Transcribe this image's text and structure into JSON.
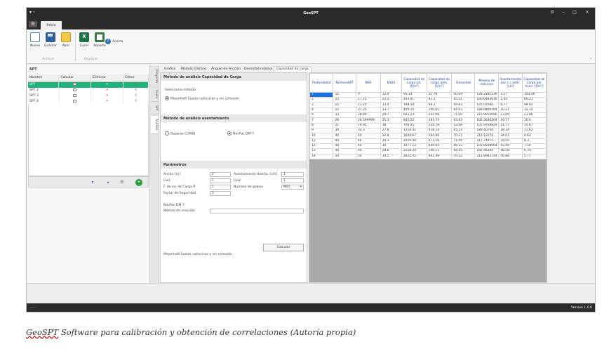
{
  "window": {
    "title": "GeoSPT",
    "controls": [
      "⊡",
      "–",
      "□",
      "×"
    ]
  },
  "menu": {
    "file_icon": "☰",
    "tab": "Inicio"
  },
  "ribbon": {
    "buttons": [
      {
        "label": "Nuevo",
        "icon": "new-file-icon"
      },
      {
        "label": "Guardar",
        "icon": "save-icon"
      },
      {
        "label": "Abrir",
        "icon": "open-folder-icon"
      },
      {
        "label": "Excel",
        "icon": "excel-icon"
      },
      {
        "label": "Reporte",
        "icon": "report-icon"
      }
    ],
    "about": "Acerca",
    "groups": [
      "Archivo",
      "Exportar"
    ]
  },
  "spt_panel": {
    "title": "SPT",
    "columns": [
      "Nombre",
      "Calcular",
      "Eliminar",
      "Editar"
    ],
    "rows": [
      {
        "name": "SPT",
        "selected": true
      },
      {
        "name": "SPT 2",
        "selected": false
      },
      {
        "name": "SPT 3",
        "selected": false
      },
      {
        "name": "SPT 4",
        "selected": false
      }
    ],
    "side_tabs": [
      "Proyecto",
      "Suelo",
      "SPT",
      "Análisis"
    ]
  },
  "subtabs": [
    "Grafico",
    "Módulo Elástico",
    "Ángulo de Fricción",
    "Densidad relativa",
    "Capacidad de carga"
  ],
  "capacity": {
    "section1_title": "Método de análisis Capacidad de Carga",
    "select_method": "Seleccione método",
    "method_option": "Meyerhoft Suelos cohesivos y sin cohesión",
    "section2_title": "Método de análisis asentamiento",
    "settlement_options": [
      "Bazaraa (1996)",
      "NavFac DM 7"
    ],
    "section3_title": "Parámetros",
    "params": {
      "ancho_label": "Ancho [m]",
      "ancho_value": "2",
      "asent_label": "Asentamiento diseño. [cm]",
      "asent_value": "1",
      "cw1_label": "Cw1",
      "cw1_value": "1",
      "cw2_label": "Cw2",
      "cw2_value": "1",
      "finc_label": "F. de inc de Carga R",
      "finc_value": "1",
      "golpes_label": "Numero de golpes",
      "golpes_value": "N60",
      "fs_label": "Factor de Seguridad",
      "fs_value": "3"
    },
    "navfac_title": "NavFac DM 7",
    "modulo_label": "Módulo de reacción",
    "calc_button": "Calcular",
    "footer_text": "Meyerhoft Suelos cohesivos y sin cohesión"
  },
  "grid": {
    "headers": [
      "Profundidad",
      "NumeroSPT",
      "N60",
      "N160",
      "Capacidad de carga ult. [t/m²]",
      "Capacidad de carga adm. [t/m²]",
      "Densidad",
      "Modulo de reaccion",
      "Asentamiento por c.c adm. [cm]",
      "Capacidad de carga por Asen. [t/m²]"
    ],
    "rows": [
      [
        "1",
        "12",
        "9",
        "12.4",
        "95.33",
        "31.78",
        "50.64",
        "128.2181536",
        "3.17",
        "103.46"
      ],
      [
        "2",
        "23",
        "17.25",
        "22.2",
        "243.61",
        "81.2",
        "65.51",
        "190.6483616",
        "5.45",
        "60.21"
      ],
      [
        "3",
        "15",
        "11.25",
        "13.4",
        "198.59",
        "66.2",
        "49.83",
        "125.02066...",
        "6.77",
        "48.42"
      ],
      [
        "4",
        "25",
        "21.25",
        "23.7",
        "450.15",
        "150.05",
        "64.93",
        "188.0806784",
        "10.21",
        "32.14"
      ],
      [
        "5",
        "33",
        "28.05",
        "29.7",
        "693.23",
        "231.08",
        "71.09",
        "215.9012096",
        "13.69",
        "23.96"
      ],
      [
        "7",
        "28",
        "26.599999...",
        "25.3",
        "845.22",
        "281.74",
        "63.63",
        "182.3646304",
        "19.77",
        "16.6"
      ],
      [
        "8",
        "21",
        "19.95",
        "18",
        "704.35",
        "234.78",
        "53.08",
        "137.9769824",
        "21.77",
        "15.07"
      ],
      [
        "9",
        "34",
        "32.3",
        "27.8",
        "1254.41",
        "418.14",
        "65.23",
        "189.40744...",
        "28.24",
        "11.62"
      ],
      [
        "10",
        "40",
        "40",
        "32.8",
        "1694.67",
        "564.89",
        "70.27",
        "212.12276...",
        "34.07",
        "9.63"
      ],
      [
        "11",
        "44",
        "44",
        "34.3",
        "2019.48",
        "673.16",
        "71.49",
        "217.74972...",
        "39.55",
        "8.3"
      ],
      [
        "12",
        "40",
        "40",
        "30",
        "1977.12",
        "659.04",
        "66.23",
        "193.8508064",
        "43.49",
        "7.54"
      ],
      [
        "13",
        "40",
        "40",
        "28.8",
        "2118.34",
        "706.11",
        "64.45",
        "185.96384",
        "48.58",
        "6.75"
      ],
      [
        "14",
        "50",
        "50",
        "34.5",
        "2824.45",
        "941.48",
        "70.22",
        "211.8983744",
        "56.84",
        "5.77"
      ]
    ]
  },
  "status": {
    "left": "------",
    "version": "Version 1.0.0"
  },
  "caption": {
    "prefix": "GeoSPT",
    "rest": " Software para calibración y obtención de correlaciones (Autoría propia)"
  }
}
